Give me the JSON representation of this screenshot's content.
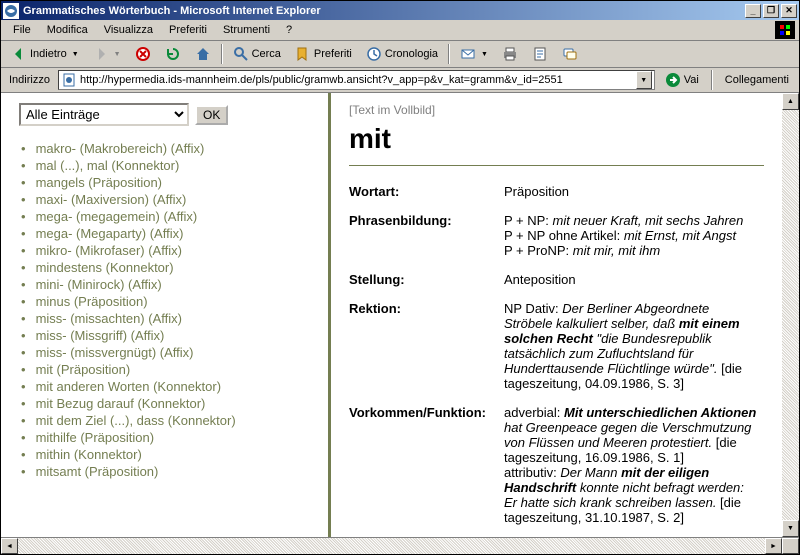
{
  "window": {
    "title": "Grammatisches Wörterbuch - Microsoft Internet Explorer"
  },
  "menubar": [
    "File",
    "Modifica",
    "Visualizza",
    "Preferiti",
    "Strumenti",
    "?"
  ],
  "toolbar": {
    "back": "Indietro",
    "search": "Cerca",
    "favorites": "Preferiti",
    "history": "Cronologia"
  },
  "addressbar": {
    "label": "Indirizzo",
    "url": "http://hypermedia.ids-mannheim.de/pls/public/gramwb.ansicht?v_app=p&v_kat=gramm&v_id=2551",
    "go": "Vai",
    "links": "Collegamenti"
  },
  "sidebar": {
    "filter_selected": "Alle Einträge",
    "ok": "OK",
    "entries": [
      "makro- (Makrobereich) (Affix)",
      "mal (...), mal (Konnektor)",
      "mangels (Präposition)",
      "maxi- (Maxiversion) (Affix)",
      "mega- (megagemein) (Affix)",
      "mega- (Megaparty) (Affix)",
      "mikro- (Mikrofaser) (Affix)",
      "mindestens (Konnektor)",
      "mini- (Minirock) (Affix)",
      "minus (Präposition)",
      "miss- (missachten) (Affix)",
      "miss- (Missgriff) (Affix)",
      "miss- (missvergnügt) (Affix)",
      "mit (Präposition)",
      "mit anderen Worten (Konnektor)",
      "mit Bezug darauf (Konnektor)",
      "mit dem Ziel (...), dass (Konnektor)",
      "mithilfe (Präposition)",
      "mithin (Konnektor)",
      "mitsamt (Präposition)"
    ]
  },
  "article": {
    "vollbild": "[Text im Vollbild]",
    "headword": "mit",
    "rows": {
      "wortart": {
        "label": "Wortart:",
        "value": "Präposition"
      },
      "phrasenbildung": {
        "label": "Phrasenbildung:",
        "lines": [
          "P + NP: <strong><em>mit</em></strong><em> neuer Kraft, </em><strong><em>mit</em></strong><em> sechs Jahren</em>",
          "P + NP ohne Artikel: <strong><em>mit</em></strong><em> Ernst, </em><strong><em>mit</em></strong><em> Angst</em>",
          "P + ProNP: <strong><em>mit</em></strong><em> mir, </em><strong><em>mit</em></strong><em> ihm</em>"
        ]
      },
      "stellung": {
        "label": "Stellung:",
        "value": "Anteposition"
      },
      "rektion": {
        "label": "Rektion:",
        "html": "NP Dativ: <em>Der Berliner Abgeordnete Ströbele kalkuliert selber, daß <strong>mit einem solchen Recht</strong> \"die Bundesrepublik tatsächlich zum Zufluchtsland für Hunderttausende Flüchtlinge würde\".</em> [die tageszeitung, 04.09.1986, S. 3]"
      },
      "vorkommen": {
        "label": "Vorkommen/Funktion:",
        "html": "adverbial: <em><strong>Mit unterschiedlichen Aktionen</strong> hat Greenpeace gegen die Verschmutzung von Flüssen und Meeren protestiert.</em> [die tageszeitung, 16.09.1986, S. 1]<br>attributiv: <em>Der Mann <strong>mit der eiligen Handschrift</strong> konnte nicht befragt werden: Er hatte sich krank schreiben lassen.</em> [die tageszeitung, 31.10.1987, S. 2]"
      }
    }
  }
}
